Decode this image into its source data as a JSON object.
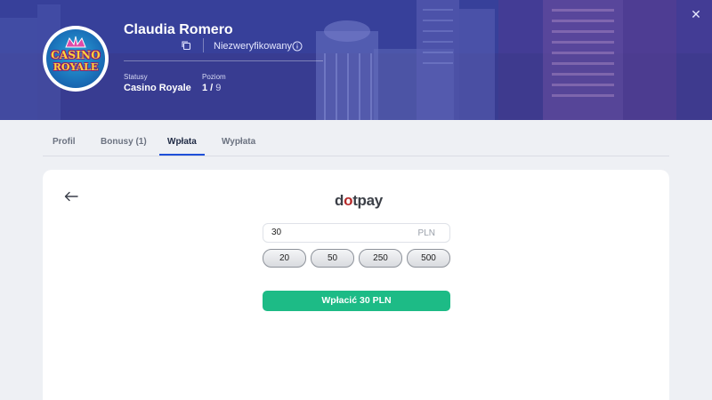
{
  "header": {
    "close_icon": "close-icon",
    "logo": {
      "line1": "CASINO",
      "line2": "ROYALE"
    },
    "user_name": "Claudia Romero",
    "verification_status": "Niezweryfikowany",
    "status": {
      "label": "Statusy",
      "value": "Casino Royale"
    },
    "level": {
      "label": "Poziom",
      "current": "1",
      "separator": " / ",
      "total": "9"
    }
  },
  "tabs": [
    {
      "label": "Profil",
      "active": false
    },
    {
      "label": "Bonusy (1)",
      "active": false
    },
    {
      "label": "Wpłata",
      "active": true
    },
    {
      "label": "Wypłata",
      "active": false
    }
  ],
  "deposit": {
    "provider_name_part1": "d",
    "provider_name_dot": "o",
    "provider_name_part2": "tpay",
    "amount_value": "30",
    "currency": "PLN",
    "presets": [
      "20",
      "50",
      "250",
      "500"
    ],
    "submit_label": "Wpłacić 30 PLN"
  },
  "colors": {
    "accent": "#1e4fd8",
    "deposit_button": "#1dbb86",
    "header_bg": "#3b3f96"
  }
}
